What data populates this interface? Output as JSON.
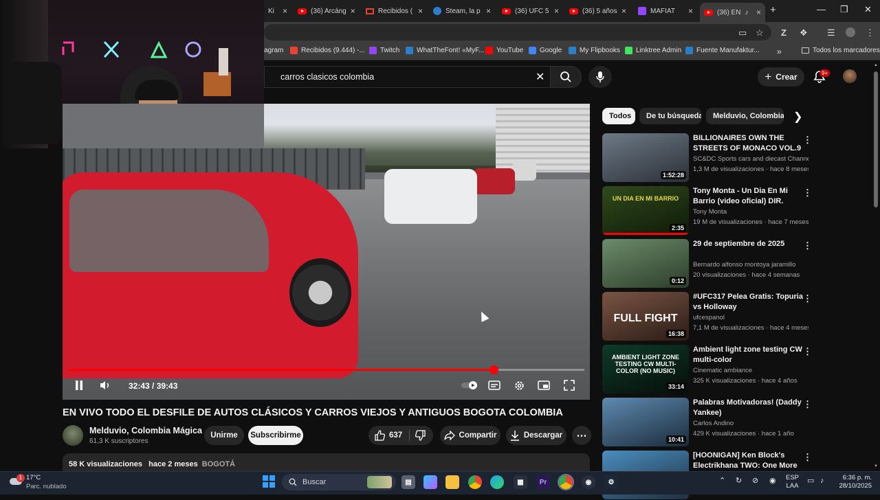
{
  "browser": {
    "tabs": [
      {
        "label": "Ki",
        "icon": "blank"
      },
      {
        "label": "(36) Arcáng",
        "icon": "youtube"
      },
      {
        "label": "Recibidos (",
        "icon": "gmail"
      },
      {
        "label": "Steam, la p",
        "icon": "steam"
      },
      {
        "label": "(36) UFC 5",
        "icon": "youtube"
      },
      {
        "label": "(36) 5 años",
        "icon": "youtube"
      },
      {
        "label": "MAFIAT",
        "icon": "purple"
      },
      {
        "label": "(36) EN",
        "icon": "youtube"
      }
    ],
    "new_tab": "+",
    "bookmarks": [
      {
        "label": "agram",
        "color": "#e1306c"
      },
      {
        "label": "Recibidos (9.444) -...",
        "color": "#ea4335"
      },
      {
        "label": "Twitch",
        "color": "#9146ff"
      },
      {
        "label": "WhatTheFont! «MyF...",
        "color": "#2a7fc9"
      },
      {
        "label": "YouTube",
        "color": "#ff0000"
      },
      {
        "label": "Google",
        "color": "#4285f4"
      },
      {
        "label": "My Flipbooks",
        "color": "#2a7fc9"
      },
      {
        "label": "Linktree Admin",
        "color": "#43e55e"
      },
      {
        "label": "Fuente Manufaktur...",
        "color": "#2a7fc9"
      }
    ],
    "bookmarks_overflow": "»",
    "all_bookmarks": "Todos los marcadores"
  },
  "header": {
    "search_query": "carros clasicos colombia",
    "create_label": "Crear",
    "notification_count": "9+"
  },
  "player": {
    "time": "32:43 / 39:43",
    "progress": 0.824
  },
  "video": {
    "title": "EN VIVO TODO EL DESFILE DE AUTOS CLÁSICOS Y CARROS VIEJOS Y ANTIGUOS BOGOTA COLOMBIA",
    "channel": "Melduvio, Colombia Mágica",
    "subscribers": "61,3 K suscriptores",
    "join_label": "Unirme",
    "subscribe_label": "Subscribirme",
    "likes": "637",
    "share_label": "Compartir",
    "download_label": "Descargar",
    "views": "58 K visualizaciones",
    "age": "hace 2 meses",
    "location_tag": "BOGOTÁ"
  },
  "chips": [
    {
      "label": "Todos",
      "active": true
    },
    {
      "label": "De tu búsqueda",
      "active": false
    },
    {
      "label": "Melduvio, Colombia M",
      "active": false
    }
  ],
  "recommendations": [
    {
      "title": "BILLIONAIRES OWN THE STREETS OF MONACO VOL.9",
      "channel": "SC&DC Sports cars and diecast Channel",
      "meta": "1,3 M de visualizaciones · hace 8 meses",
      "duration": "1:52:28",
      "colors": [
        "#6d7a86",
        "#2b3038"
      ]
    },
    {
      "title": "Tony Monta - Un Dia En Mi Barrio (video oficial) DIR. John...",
      "channel": "Tony Monta",
      "meta": "19 M de visualizaciones · hace 7 meses",
      "duration": "2:35",
      "colors": [
        "#2f4a1c",
        "#0f1a08"
      ],
      "overlay": "UN DIA EN MI BARRIO"
    },
    {
      "title": "29 de septiembre de 2025",
      "channel": "Bernardo alfonso montoya jaramillo",
      "meta": "20 visualizaciones · hace 4 semanas",
      "duration": "0:12",
      "colors": [
        "#6b8c6b",
        "#2d3d2a"
      ]
    },
    {
      "title": "#UFC317 Pelea Gratis: Topuria vs Holloway",
      "channel": "ufcespanol",
      "meta": "7,1 M de visualizaciones · hace 4 meses",
      "duration": "16:38",
      "colors": [
        "#7a5444",
        "#2a1c16"
      ],
      "overlay": "FULL FIGHT"
    },
    {
      "title": "Ambient light zone testing CW multi-color",
      "channel": "Cinematic ambiance",
      "meta": "325 K visualizaciones · hace 4 años",
      "duration": "33:14",
      "colors": [
        "#0e3a2a",
        "#060e0a"
      ],
      "overlay": "AMBIENT LIGHT ZONE TESTING CW MULTI-COLOR (NO MUSIC)"
    },
    {
      "title": "Palabras Motivadoras! (Daddy Yankee)",
      "channel": "Carlos Andino",
      "meta": "429 K visualizaciones · hace 1 año",
      "duration": "10:41",
      "colors": [
        "#5e8ab0",
        "#1b2c3b"
      ]
    },
    {
      "title": "[HOONIGAN] Ken Block's Electrikhana TWO: One More ...",
      "channel": "",
      "meta": "",
      "duration": "",
      "colors": [
        "#4a8ec0",
        "#203040"
      ]
    }
  ],
  "taskbar": {
    "weather_temp": "17°C",
    "weather_desc": "Parc. nublado",
    "weather_badge": "1",
    "search_label": "Buscar",
    "lang_top": "ESP",
    "lang_bottom": "LAA",
    "time": "6:36 p. m.",
    "date": "28/10/2025"
  }
}
